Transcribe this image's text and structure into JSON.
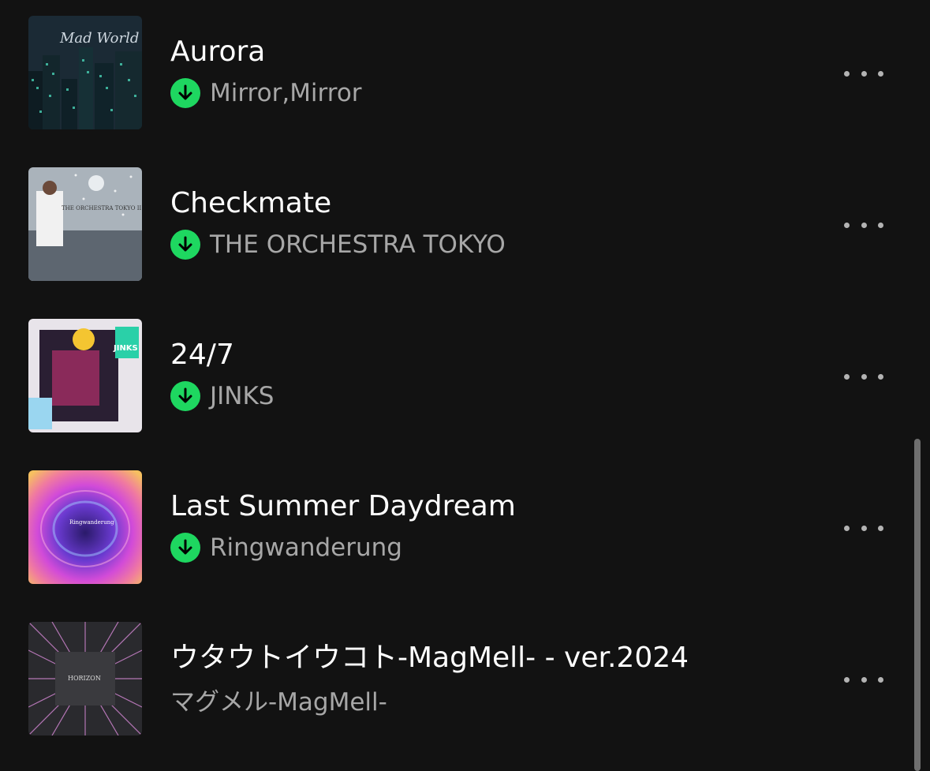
{
  "tracks": [
    {
      "title": "Aurora",
      "artist": "Mirror,Mirror",
      "downloaded": true,
      "art_icon": "album-art-night-city"
    },
    {
      "title": "Checkmate",
      "artist": "THE ORCHESTRA TOKYO",
      "downloaded": true,
      "art_icon": "album-art-snow-moon"
    },
    {
      "title": "24/7",
      "artist": "JINKS",
      "downloaded": true,
      "art_icon": "album-art-collage"
    },
    {
      "title": "Last Summer Daydream",
      "artist": "Ringwanderung",
      "downloaded": true,
      "art_icon": "album-art-swirl"
    },
    {
      "title": "ウタウトイウコト-MagMell- - ver.2024",
      "artist": "マグメル-MagMell-",
      "downloaded": false,
      "art_icon": "album-art-starburst"
    }
  ],
  "art_text": {
    "aurora": "Mad World",
    "checkmate": "THE ORCHESTRA TOKYO II",
    "jinks": "JINKS",
    "ring": "Ringwanderung",
    "horizon": "HORIZON"
  },
  "colors": {
    "background": "#121212",
    "title": "#ffffff",
    "artist": "#a7a7a7",
    "download_badge": "#1ed760"
  },
  "icons": {
    "download": "download-arrow-icon",
    "more": "more-options-icon"
  }
}
